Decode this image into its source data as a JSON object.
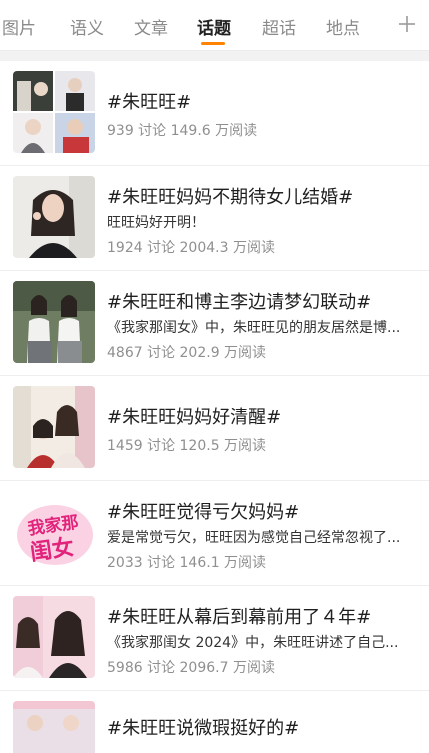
{
  "tabs": [
    {
      "label": "图片",
      "active": false
    },
    {
      "label": "语义",
      "active": false
    },
    {
      "label": "文章",
      "active": false
    },
    {
      "label": "话题",
      "active": true
    },
    {
      "label": "超话",
      "active": false
    },
    {
      "label": "地点",
      "active": false
    }
  ],
  "add_icon": "plus-icon",
  "accent_color": "#ff8200",
  "topics": [
    {
      "title": "#朱旺旺#",
      "desc": "",
      "stats": "939 讨论 149.6 万阅读"
    },
    {
      "title": "#朱旺旺妈妈不期待女儿结婚#",
      "desc": "旺旺妈好开明！",
      "stats": "1924 讨论 2004.3 万阅读"
    },
    {
      "title": "#朱旺旺和博主李边请梦幻联动#",
      "desc": "《我家那闺女》中，朱旺旺见的朋友居然是博...",
      "stats": "4867 讨论 202.9 万阅读"
    },
    {
      "title": "#朱旺旺妈妈好清醒#",
      "desc": "",
      "stats": "1459 讨论 120.5 万阅读"
    },
    {
      "title": "#朱旺旺觉得亏欠妈妈#",
      "desc": "爱是常觉亏欠，旺旺因为感觉自己经常忽视了...",
      "stats": "2033 讨论 146.1 万阅读"
    },
    {
      "title": "#朱旺旺从幕后到幕前用了４年#",
      "desc": "《我家那闺女 2024》中，朱旺旺讲述了自己...",
      "stats": "5986 讨论 2096.7 万阅读"
    },
    {
      "title": "#朱旺旺说微瑕挺好的#",
      "desc": "",
      "stats": ""
    }
  ],
  "thumb_logo_text": {
    "line1": "我家那",
    "line2": "闺女"
  }
}
